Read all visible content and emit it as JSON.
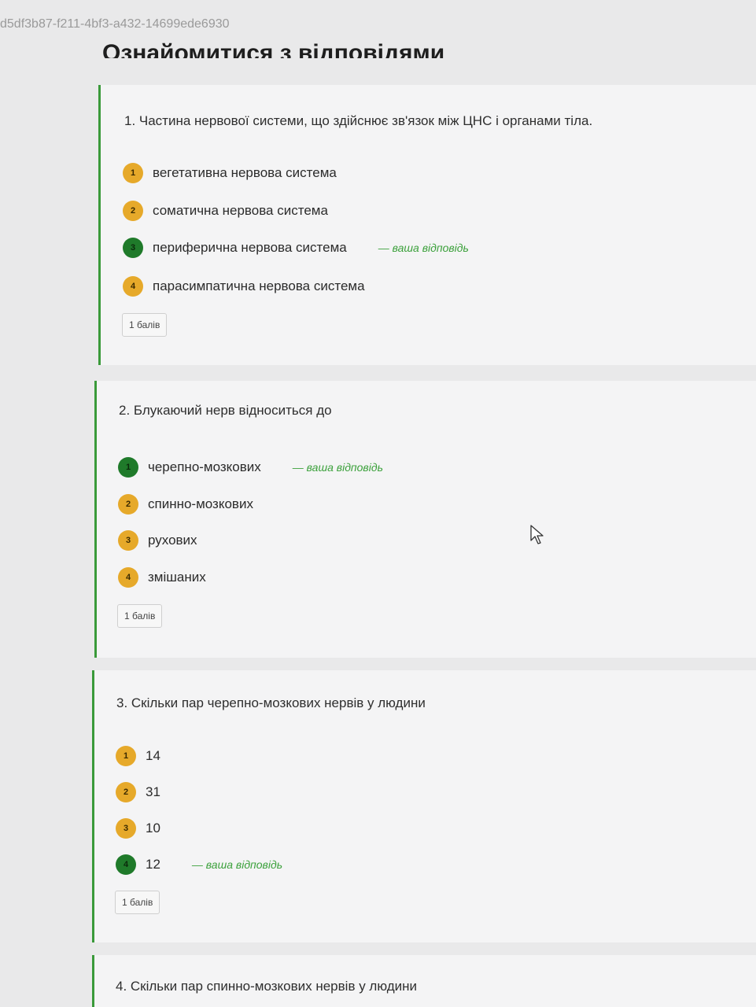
{
  "url_text": "d5df3b87-f211-4bf3-a432-14699ede6930",
  "page_title": "Ознайомитися з відповідями",
  "answer_marker": "— ваша відповідь",
  "questions": [
    {
      "text": "1. Частина нервової системи, що здійснює зв'язок між ЦНС і органами тіла.",
      "points": "1 балів",
      "options": [
        {
          "num": "1",
          "label": "вегетативна нервова система"
        },
        {
          "num": "2",
          "label": "соматична нервова система"
        },
        {
          "num": "3",
          "label": "периферична нервова система"
        },
        {
          "num": "4",
          "label": "парасимпатична нервова система"
        }
      ]
    },
    {
      "text": "2. Блукаючий нерв відноситься до",
      "points": "1 балів",
      "options": [
        {
          "num": "1",
          "label": "черепно-мозкових"
        },
        {
          "num": "2",
          "label": "спинно-мозкових"
        },
        {
          "num": "3",
          "label": "рухових"
        },
        {
          "num": "4",
          "label": "змішаних"
        }
      ]
    },
    {
      "text": "3. Скільки пар черепно-мозкових нервів у людини",
      "points": "1 балів",
      "options": [
        {
          "num": "1",
          "label": "14"
        },
        {
          "num": "2",
          "label": "31"
        },
        {
          "num": "3",
          "label": "10"
        },
        {
          "num": "4",
          "label": "12"
        }
      ]
    },
    {
      "text": "4. Скільки пар спинно-мозкових нервів у людини"
    }
  ],
  "colors": {
    "badge_default": "#e6a92a",
    "badge_selected": "#1f7a2a",
    "accent_border": "#3a9a3a",
    "your_answer_text": "#3aa03a"
  }
}
